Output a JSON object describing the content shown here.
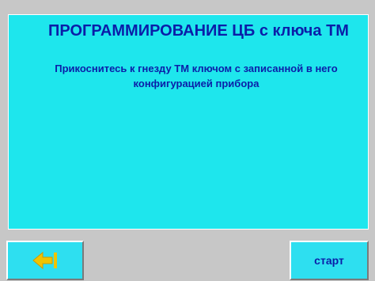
{
  "screen": {
    "title": "ПРОГРАММИРОВАНИЕ ЦБ с ключа ТМ",
    "message": "Прикоснитесь к гнезду ТМ ключом с записанной в него конфигурацией прибора"
  },
  "buttons": {
    "back_icon": "back-arrow-icon",
    "start_label": "старт"
  },
  "colors": {
    "panel": "#1ee6ed",
    "button": "#2edff0",
    "text": "#0b1ea8",
    "background": "#c7c7c7",
    "icon": "#f0c400"
  }
}
